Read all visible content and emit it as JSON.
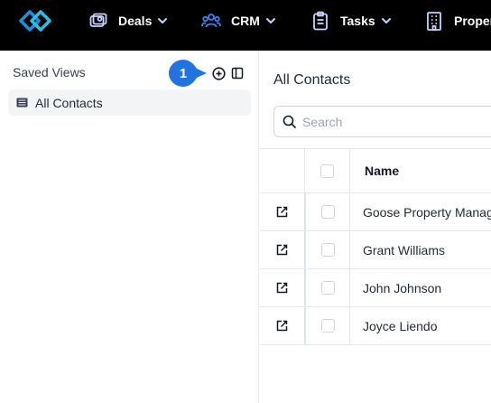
{
  "header": {
    "nav": [
      {
        "label": "Deals",
        "icon": "money-icon"
      },
      {
        "label": "CRM",
        "icon": "users-icon"
      },
      {
        "label": "Tasks",
        "icon": "clipboard-icon"
      },
      {
        "label": "Proper",
        "icon": "building-icon"
      }
    ]
  },
  "sidebar": {
    "title": "Saved Views",
    "badge": "1",
    "views": [
      {
        "label": "All Contacts",
        "icon": "list-icon"
      }
    ]
  },
  "main": {
    "title": "All Contacts",
    "search_placeholder": "Search",
    "columns": {
      "name": "Name"
    },
    "rows": [
      {
        "name": "Goose Property Manag"
      },
      {
        "name": "Grant Williams"
      },
      {
        "name": "John Johnson"
      },
      {
        "name": "Joyce Liendo"
      }
    ]
  },
  "colors": {
    "header_bg": "#000000",
    "accent": "#2563eb",
    "badge": "#2174e0",
    "logo_primary": "#1d8fe1",
    "logo_secondary": "#22c3e6"
  }
}
